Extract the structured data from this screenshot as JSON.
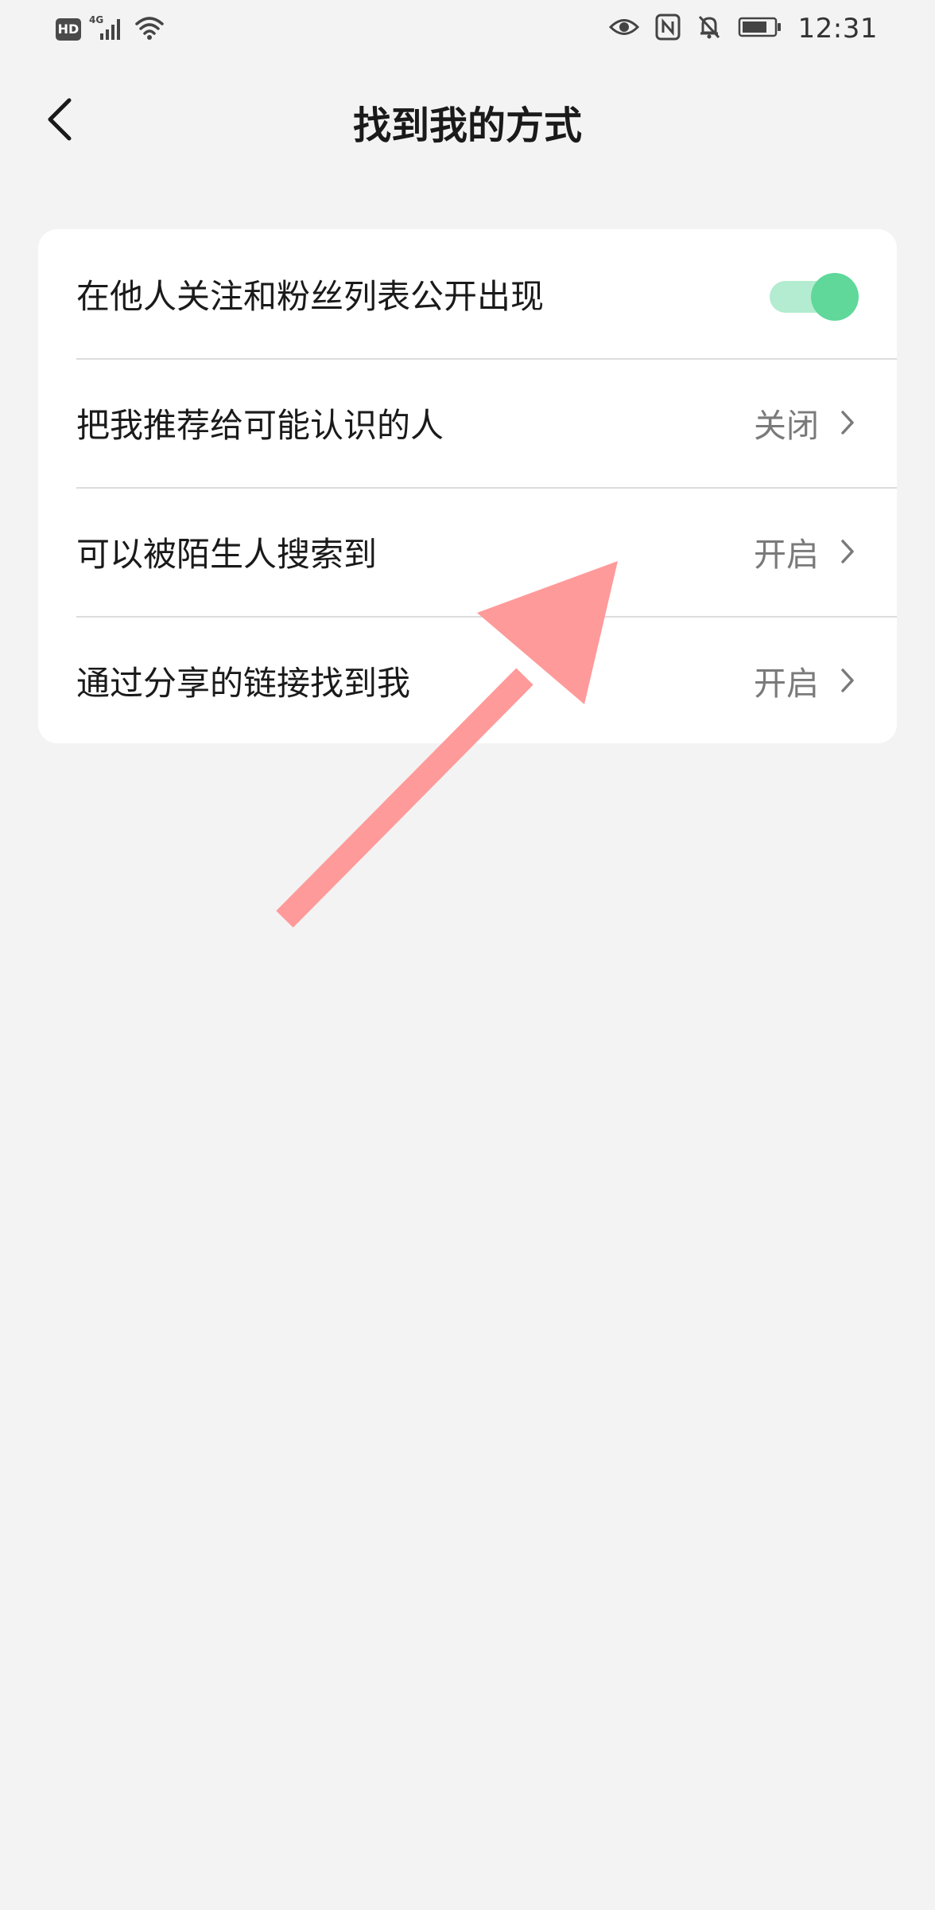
{
  "status_bar": {
    "left_badge": "HD",
    "network": "4G",
    "time": "12:31",
    "icons": [
      "hd-icon",
      "signal-icon",
      "wifi-icon",
      "eye-icon",
      "nfc-icon",
      "bell-off-icon",
      "battery-icon"
    ]
  },
  "nav": {
    "title": "找到我的方式",
    "back_icon": "chevron-left-icon"
  },
  "settings": {
    "items": [
      {
        "label": "在他人关注和粉丝列表公开出现",
        "type": "toggle",
        "enabled": true
      },
      {
        "label": "把我推荐给可能认识的人",
        "type": "link",
        "value": "关闭"
      },
      {
        "label": "可以被陌生人搜索到",
        "type": "link",
        "value": "开启"
      },
      {
        "label": "通过分享的链接找到我",
        "type": "link",
        "value": "开启"
      }
    ]
  },
  "colors": {
    "background": "#f3f3f3",
    "card": "#ffffff",
    "toggle_on_knob": "#5fd89a",
    "toggle_on_track": "#b3ecd0",
    "annotation_arrow": "#ff9a9a"
  }
}
